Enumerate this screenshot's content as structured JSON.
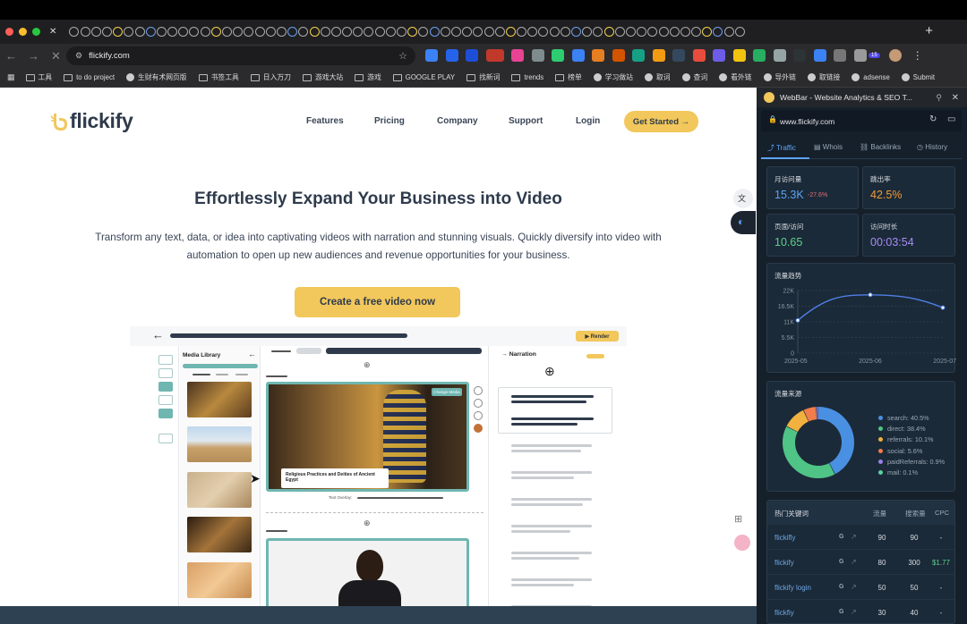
{
  "browser": {
    "address": "flickify.com",
    "bookmarks": [
      "工具",
      "to do project",
      "生财有术网页版",
      "书签工具",
      "日入万刀",
      "游戏大站",
      "游戏",
      "GOOGLE PLAY",
      "找新词",
      "trends",
      "榜单",
      "学习做站",
      "取词",
      "查词",
      "看外链",
      "导外链",
      "取链接",
      "adsense",
      "Submit"
    ],
    "tab_avatar_badge": "15"
  },
  "site": {
    "logo": "flickify",
    "nav": [
      "Features",
      "Pricing",
      "Company",
      "Support",
      "Login"
    ],
    "get_started": "Get Started →",
    "hero_title": "Effortlessly Expand Your Business into Video",
    "hero_sub": "Transform any text, data, or idea into captivating videos with narration and stunning visuals.  Quickly diversify into video with automation to open up new audiences and revenue opportunities for your business.",
    "cta": "Create a free video now",
    "mock": {
      "render": "▶ Render",
      "media_library": "Media Library",
      "narration": "Narration",
      "caption": "Religious Practices and Deities of Ancient Egypt",
      "text_overlay": "Text Overlay:",
      "change_media": "Change Media"
    }
  },
  "webbar": {
    "title": "WebBar - Website Analytics & SEO T...",
    "domain": "www.flickify.com",
    "tabs": [
      "Traffic",
      "Whois",
      "Backlinks",
      "History"
    ],
    "stats": [
      {
        "label": "月访问量",
        "value": "15.3K",
        "delta": "-27.6%",
        "color": "#5ea3f5"
      },
      {
        "label": "跳出率",
        "value": "42.5%",
        "color": "#f29b38"
      },
      {
        "label": "页面/访问",
        "value": "10.65",
        "color": "#5fd08a"
      },
      {
        "label": "访问时长",
        "value": "00:03:54",
        "color": "#a78bfa"
      }
    ],
    "trend_title": "流量趋势",
    "sources_title": "流量来源",
    "sources": [
      {
        "label": "search: 40.5%",
        "value": 40.5,
        "color": "#4a90e2"
      },
      {
        "label": "direct: 38.4%",
        "value": 38.4,
        "color": "#4fc486"
      },
      {
        "label": "referrals: 10.1%",
        "value": 10.1,
        "color": "#f0b13e"
      },
      {
        "label": "social: 5.6%",
        "value": 5.6,
        "color": "#f07d4a"
      },
      {
        "label": "paidReferrals: 0.9%",
        "value": 0.9,
        "color": "#9b7fe8"
      },
      {
        "label": "mail: 0.1%",
        "value": 0.1,
        "color": "#5fd0a0"
      }
    ],
    "kw_header": [
      "热门关键词",
      "流量",
      "搜索量",
      "CPC"
    ],
    "keywords": [
      {
        "k": "flickifly",
        "g": "G",
        "t": "90",
        "s": "90",
        "c": "-",
        "cc": "#d8dde3"
      },
      {
        "k": "flickify",
        "g": "G",
        "t": "80",
        "s": "300",
        "c": "$1.77",
        "cc": "#5fd08a"
      },
      {
        "k": "flickify login",
        "g": "G",
        "t": "50",
        "s": "50",
        "c": "-",
        "cc": "#d8dde3"
      },
      {
        "k": "flickfiy",
        "g": "G",
        "t": "30",
        "s": "40",
        "c": "-",
        "cc": "#d8dde3"
      }
    ]
  },
  "chart_data": {
    "type": "line",
    "title": "流量趋势",
    "x": [
      "2025-05",
      "2025-06",
      "2025-07"
    ],
    "series": [
      {
        "values": [
          11500,
          20500,
          16000
        ]
      }
    ],
    "ylim": [
      0,
      22000
    ],
    "yticks": [
      "0",
      "5.5K",
      "11K",
      "16.5K",
      "22K"
    ],
    "yticks_values": [
      0,
      5500,
      11000,
      16500,
      22000
    ],
    "color": "#4f7fe6",
    "grid": true
  }
}
